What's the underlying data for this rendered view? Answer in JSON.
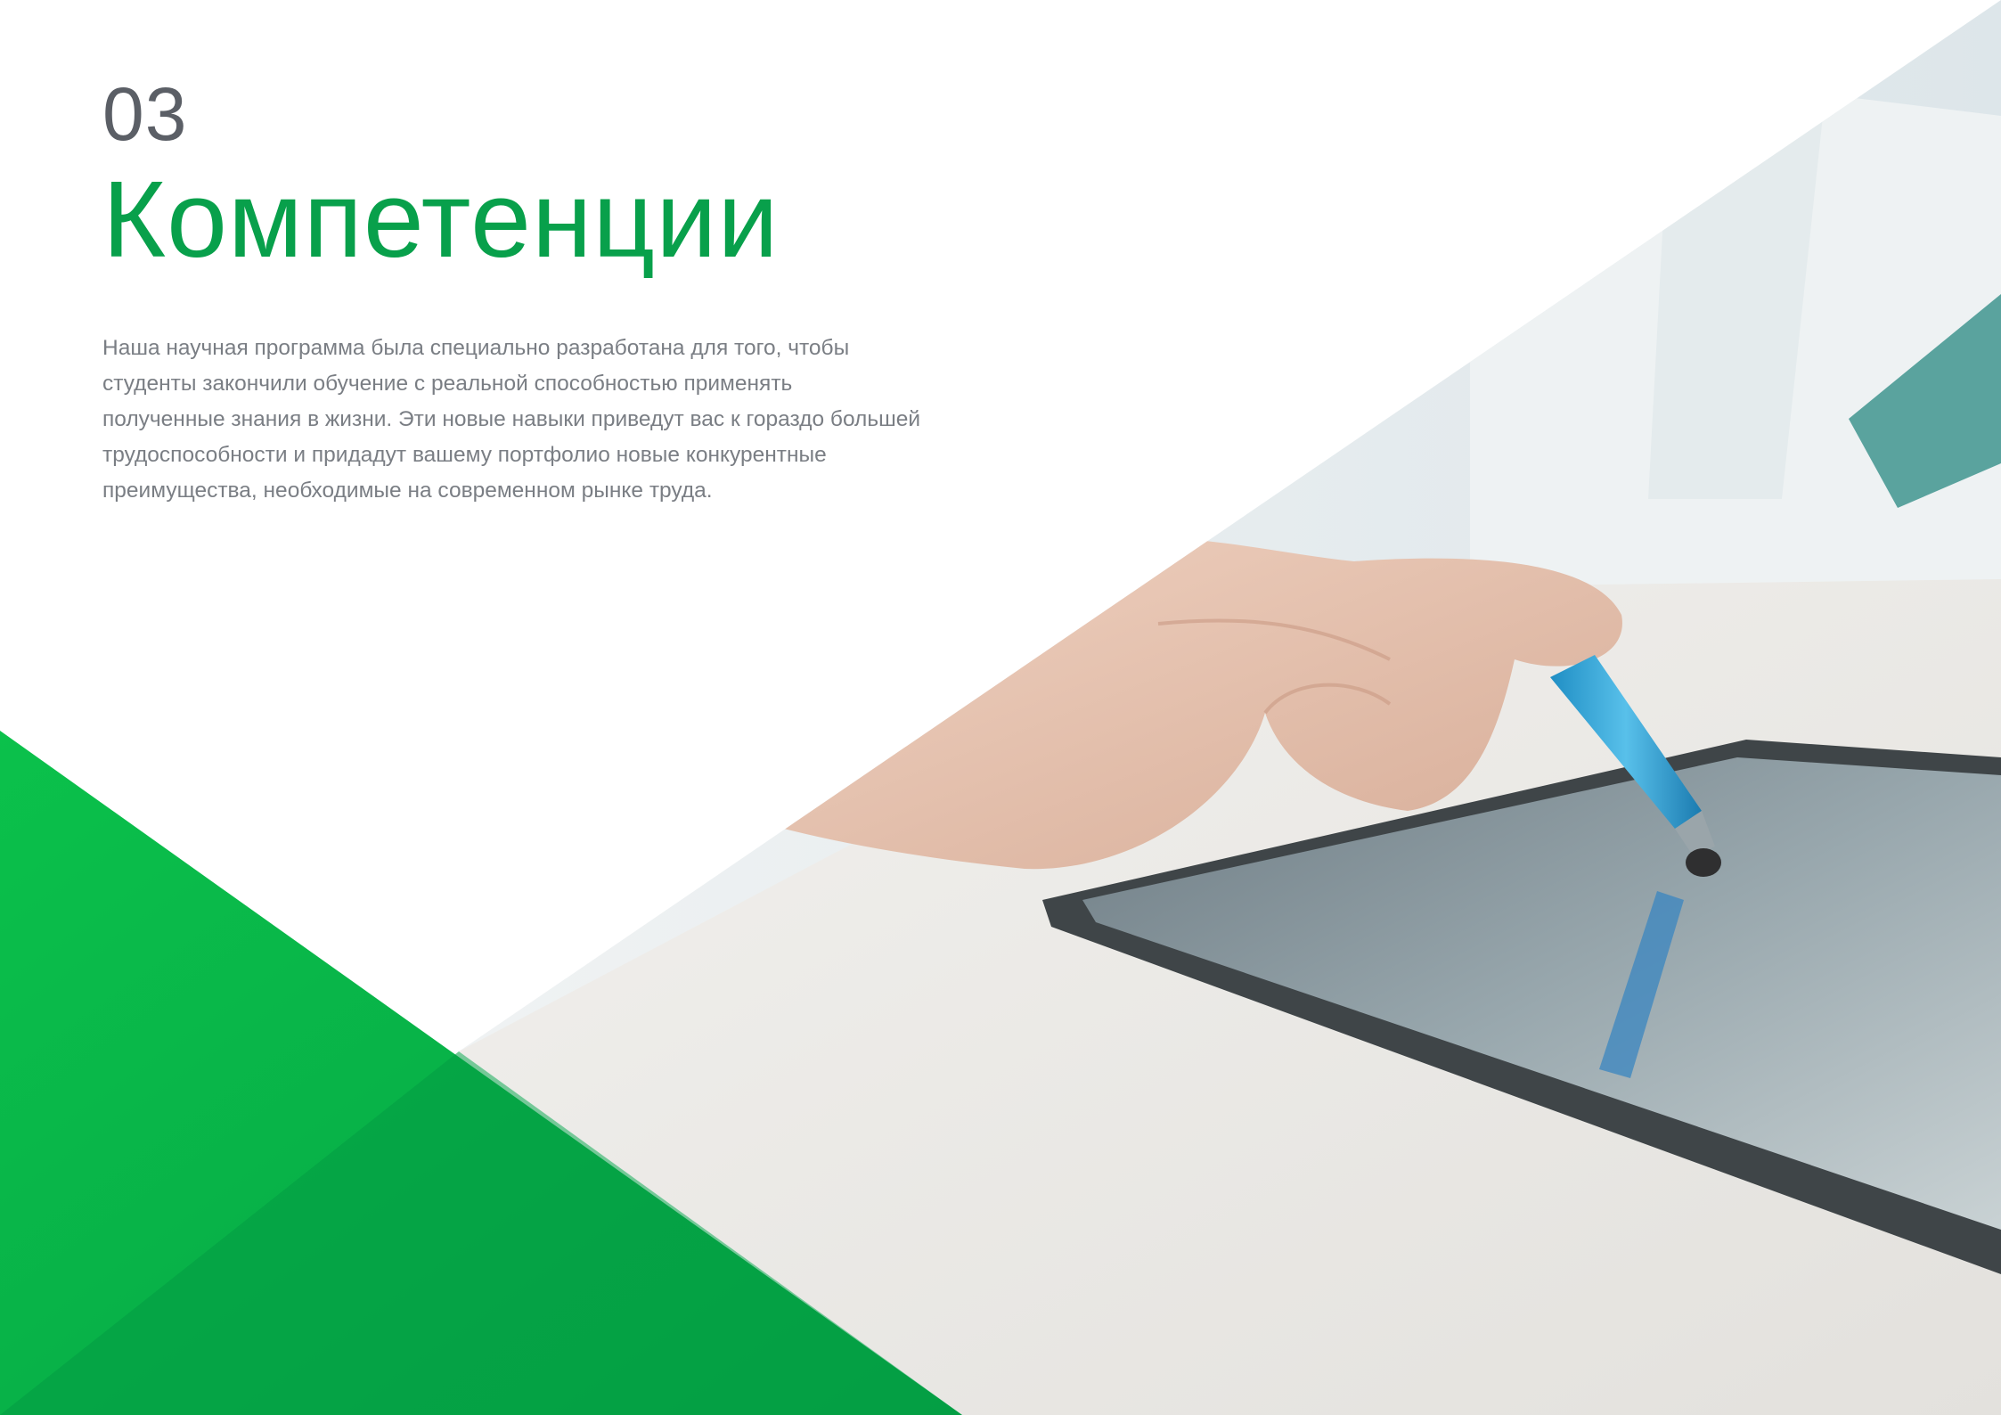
{
  "page": {
    "section_number": "03",
    "title": "Компетенции",
    "body_lines": [
      "Наша научная программа была специально разработана для того, чтобы",
      "студенты закончили обучение с реальной способностью применять",
      "полученные знания в жизни. Эти новые навыки приведут вас к гораздо большей",
      "трудоспособности и придадут вашему портфолио новые конкурентные",
      "преимущества, необходимые на современном рынке труда."
    ]
  },
  "colors": {
    "accent_green": "#08a04b",
    "light_green": "#0cbf4a",
    "text_gray": "#7a7e84",
    "number_gray": "#5b5f66"
  },
  "image": {
    "subject": "hand holding blue stylus touching a tablet on a white desk"
  }
}
